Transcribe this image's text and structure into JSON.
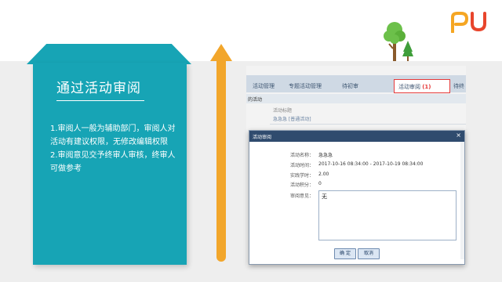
{
  "card": {
    "title": "通过活动审阅",
    "lines": [
      "1.审阅人一般为辅助部门，审阅人对",
      "活动有建议权限，无修改编辑权限",
      "2.审阅意见交予终审人审核，终审人",
      "可做参考"
    ]
  },
  "logo": {
    "text": "PU",
    "colors": [
      "#f5a623",
      "#e8452c"
    ]
  },
  "screenshot": {
    "nav": {
      "items": [
        "活动管理",
        "专题活动管理",
        "待初审"
      ],
      "active_label": "活动审阅",
      "active_count": "(1)",
      "overflow": "待终"
    },
    "sub_tab": "的活动",
    "column_header": "活动标题",
    "row_title": "急急急 [普通活动]",
    "dialog": {
      "title": "活动审阅",
      "close": "×",
      "fields": [
        {
          "label": "活动名称：",
          "value": "急急急"
        },
        {
          "label": "活动时间：",
          "value": "2017-10-16 08:34:00 - 2017-10-19 08:34:00"
        },
        {
          "label": "实践学时：",
          "value": "2.00"
        },
        {
          "label": "活动积分：",
          "value": "0"
        }
      ],
      "opinion_label": "审阅意见：",
      "opinion_value": "无",
      "confirm": "确 定",
      "cancel": "取消"
    }
  },
  "colors": {
    "teal": "#17a4b5",
    "orange": "#f2a62b",
    "highlight": "#e53a3a",
    "dialog_header": "#2f4b6e"
  }
}
